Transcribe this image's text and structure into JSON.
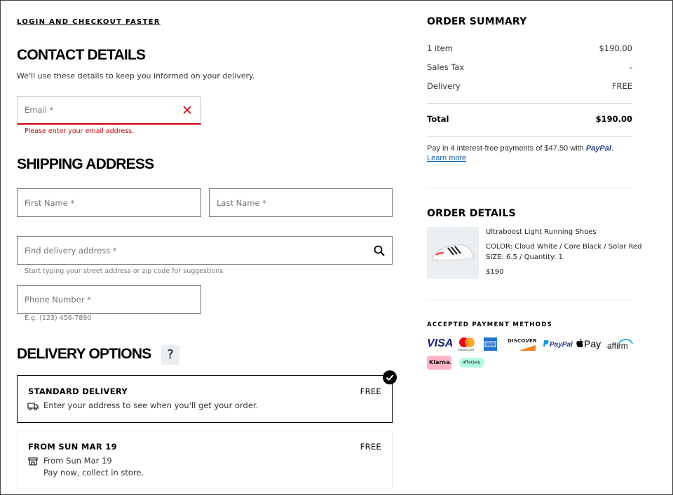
{
  "top_link": "LOGIN AND CHECKOUT FASTER",
  "contact": {
    "heading": "CONTACT DETAILS",
    "subtext": "We'll use these details to keep you informed on your delivery.",
    "email_placeholder": "Email *",
    "email_error": "Please enter your email address."
  },
  "shipping": {
    "heading": "SHIPPING ADDRESS",
    "first_name": "First Name *",
    "last_name": "Last Name *",
    "address": "Find delivery address *",
    "address_hint": "Start typing your street address or zip code for suggestions",
    "phone": "Phone Number *",
    "phone_hint": "E.g. (123) 456-7890"
  },
  "delivery": {
    "heading": "DELIVERY OPTIONS",
    "help": "?",
    "options": [
      {
        "title": "STANDARD DELIVERY",
        "price": "FREE",
        "line1": "Enter your address to see when you'll get your order.",
        "selected": true
      },
      {
        "title": "FROM SUN MAR 19",
        "price": "FREE",
        "line1": "From Sun Mar 19",
        "line2": "Pay now, collect in store.",
        "selected": false
      }
    ]
  },
  "summary": {
    "heading": "ORDER SUMMARY",
    "rows": [
      {
        "label": "1 item",
        "value": "$190.00"
      },
      {
        "label": "Sales Tax",
        "value": "-"
      },
      {
        "label": "Delivery",
        "value": "FREE"
      }
    ],
    "total_label": "Total",
    "total_value": "$190.00",
    "paypal_text": "Pay in 4 interest-free payments of $47.50 with",
    "paypal_brand": "PayPal",
    "paypal_dot": ".",
    "learn_more": "Learn more"
  },
  "order_details": {
    "heading": "ORDER DETAILS",
    "product_name": "Ultraboost Light Running Shoes",
    "color": "COLOR: Cloud White / Core Black / Solar Red",
    "size_qty": "SIZE: 6.5 / Quantity: 1",
    "price": "$190"
  },
  "payment": {
    "heading": "ACCEPTED PAYMENT METHODS",
    "visa": "VISA",
    "mastercard": "mastercard",
    "discover": "DISCOVER",
    "paypal": "PayPal",
    "applepay": "Pay",
    "affirm": "affirm",
    "klarna": "Klarna.",
    "afterpay": "afterpay"
  },
  "colors": {
    "error": "#d0000a",
    "paypal_dark": "#253b80",
    "paypal_light": "#179bd7",
    "klarna": "#ffb3c7",
    "afterpay": "#b2fce4"
  }
}
